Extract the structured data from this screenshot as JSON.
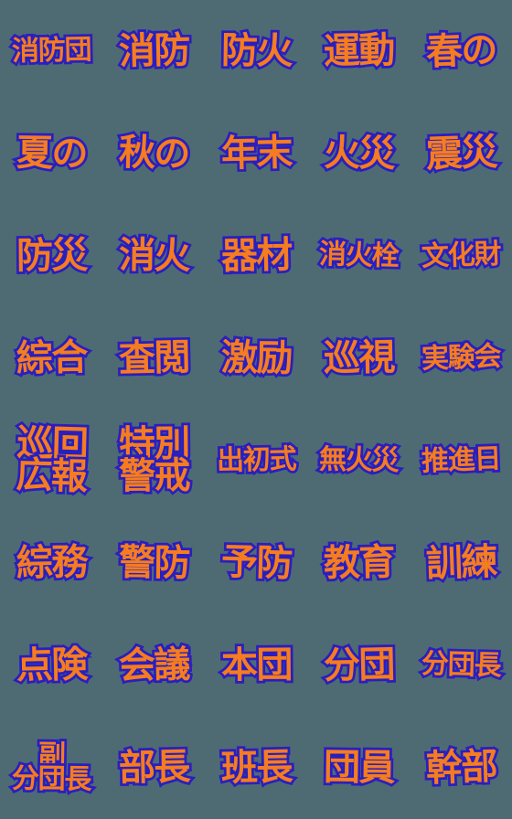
{
  "sheet": {
    "background_color": "#4e6b74",
    "text_color": "#f57c20",
    "outline_color": "#2a1fbe",
    "columns": 5,
    "rows": 8,
    "total_stickers": 40
  },
  "stickers": [
    {
      "id": "shoubou-dan",
      "lines": [
        "消防団"
      ],
      "text": "消防団"
    },
    {
      "id": "shoubou",
      "lines": [
        "消防"
      ],
      "text": "消防"
    },
    {
      "id": "bouka",
      "lines": [
        "防火"
      ],
      "text": "防火"
    },
    {
      "id": "undou",
      "lines": [
        "運動"
      ],
      "text": "運動"
    },
    {
      "id": "haru-no",
      "lines": [
        "春の"
      ],
      "text": "春の"
    },
    {
      "id": "natsu-no",
      "lines": [
        "夏の"
      ],
      "text": "夏の"
    },
    {
      "id": "aki-no",
      "lines": [
        "秋の"
      ],
      "text": "秋の"
    },
    {
      "id": "nenmatsu",
      "lines": [
        "年末"
      ],
      "text": "年末"
    },
    {
      "id": "kasai",
      "lines": [
        "火災"
      ],
      "text": "火災"
    },
    {
      "id": "shinsai",
      "lines": [
        "震災"
      ],
      "text": "震災"
    },
    {
      "id": "bousai",
      "lines": [
        "防災"
      ],
      "text": "防災"
    },
    {
      "id": "shouka",
      "lines": [
        "消火"
      ],
      "text": "消火"
    },
    {
      "id": "kizai",
      "lines": [
        "器材"
      ],
      "text": "器材"
    },
    {
      "id": "shoukasen",
      "lines": [
        "消火栓"
      ],
      "text": "消火栓"
    },
    {
      "id": "bunkazai",
      "lines": [
        "文化財"
      ],
      "text": "文化財"
    },
    {
      "id": "sougou",
      "lines": [
        "綜合"
      ],
      "text": "綜合"
    },
    {
      "id": "sanen",
      "lines": [
        "査閲"
      ],
      "text": "査閲"
    },
    {
      "id": "gekirei",
      "lines": [
        "激励"
      ],
      "text": "激励"
    },
    {
      "id": "junshi",
      "lines": [
        "巡視"
      ],
      "text": "巡視"
    },
    {
      "id": "jikkenkai",
      "lines": [
        "実験会"
      ],
      "text": "実験会"
    },
    {
      "id": "junkai-kouhou",
      "lines": [
        "巡回",
        "広報"
      ],
      "text": "巡回広報"
    },
    {
      "id": "tokubetsu-keikai",
      "lines": [
        "特別",
        "警戒"
      ],
      "text": "特別警戒"
    },
    {
      "id": "dezomeshiki",
      "lines": [
        "出初式"
      ],
      "text": "出初式"
    },
    {
      "id": "mukasai",
      "lines": [
        "無火災"
      ],
      "text": "無火災"
    },
    {
      "id": "suishinbi",
      "lines": [
        "推進日"
      ],
      "text": "推進日"
    },
    {
      "id": "soumu",
      "lines": [
        "綜務"
      ],
      "text": "綜務"
    },
    {
      "id": "keibou",
      "lines": [
        "警防"
      ],
      "text": "警防"
    },
    {
      "id": "yobou",
      "lines": [
        "予防"
      ],
      "text": "予防"
    },
    {
      "id": "kyouiku",
      "lines": [
        "教育"
      ],
      "text": "教育"
    },
    {
      "id": "kunren",
      "lines": [
        "訓練"
      ],
      "text": "訓練"
    },
    {
      "id": "tenken",
      "lines": [
        "点険"
      ],
      "text": "点険"
    },
    {
      "id": "kaigi",
      "lines": [
        "会議"
      ],
      "text": "会議"
    },
    {
      "id": "hondan",
      "lines": [
        "本団"
      ],
      "text": "本団"
    },
    {
      "id": "bundan",
      "lines": [
        "分団"
      ],
      "text": "分団"
    },
    {
      "id": "bundanchou",
      "lines": [
        "分団長"
      ],
      "text": "分団長"
    },
    {
      "id": "fuku-bundanchou",
      "lines": [
        "副",
        "分団長"
      ],
      "text": "副分団長"
    },
    {
      "id": "buchou",
      "lines": [
        "部長"
      ],
      "text": "部長"
    },
    {
      "id": "hanchou",
      "lines": [
        "班長"
      ],
      "text": "班長"
    },
    {
      "id": "danin",
      "lines": [
        "団員"
      ],
      "text": "団員"
    },
    {
      "id": "kanbu",
      "lines": [
        "幹部"
      ],
      "text": "幹部"
    }
  ]
}
